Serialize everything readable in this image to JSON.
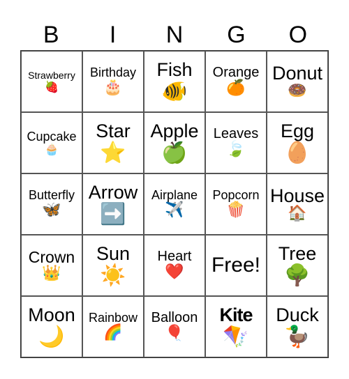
{
  "header": [
    "B",
    "I",
    "N",
    "G",
    "O"
  ],
  "cells": [
    {
      "label": "Strawberry",
      "icon": "🍓",
      "icon_name": "strawberry-icon"
    },
    {
      "label": "Birthday",
      "icon": "🎂",
      "icon_name": "birthday-cake-icon"
    },
    {
      "label": "Fish",
      "icon": "🐠",
      "icon_name": "fish-icon"
    },
    {
      "label": "Orange",
      "icon": "🍊",
      "icon_name": "orange-icon"
    },
    {
      "label": "Donut",
      "icon": "🍩",
      "icon_name": "donut-icon"
    },
    {
      "label": "Cupcake",
      "icon": "🧁",
      "icon_name": "cupcake-icon"
    },
    {
      "label": "Star",
      "icon": "⭐",
      "icon_name": "star-icon"
    },
    {
      "label": "Apple",
      "icon": "🍏",
      "icon_name": "apple-icon"
    },
    {
      "label": "Leaves",
      "icon": "🍃",
      "icon_name": "leaves-icon"
    },
    {
      "label": "Egg",
      "icon": "🥚",
      "icon_name": "egg-icon"
    },
    {
      "label": "Butterfly",
      "icon": "🦋",
      "icon_name": "butterfly-icon"
    },
    {
      "label": "Arrow",
      "icon": "➡️",
      "icon_name": "arrow-right-icon"
    },
    {
      "label": "Airplane",
      "icon": "✈️",
      "icon_name": "airplane-icon"
    },
    {
      "label": "Popcorn",
      "icon": "🍿",
      "icon_name": "popcorn-icon"
    },
    {
      "label": "House",
      "icon": "🏠",
      "icon_name": "house-icon"
    },
    {
      "label": "Crown",
      "icon": "👑",
      "icon_name": "crown-icon"
    },
    {
      "label": "Sun",
      "icon": "☀️",
      "icon_name": "sun-icon"
    },
    {
      "label": "Heart",
      "icon": "❤️",
      "icon_name": "heart-icon"
    },
    {
      "label": "Free!",
      "icon": "",
      "icon_name": ""
    },
    {
      "label": "Tree",
      "icon": "🌳",
      "icon_name": "tree-icon"
    },
    {
      "label": "Moon",
      "icon": "🌙",
      "icon_name": "moon-icon"
    },
    {
      "label": "Rainbow",
      "icon": "🌈",
      "icon_name": "rainbow-icon"
    },
    {
      "label": "Balloon",
      "icon": "🎈",
      "icon_name": "balloon-icon"
    },
    {
      "label": "Kite",
      "icon": "🪁",
      "icon_name": "kite-icon"
    },
    {
      "label": "Duck",
      "icon": "🦆",
      "icon_name": "duck-icon"
    }
  ]
}
